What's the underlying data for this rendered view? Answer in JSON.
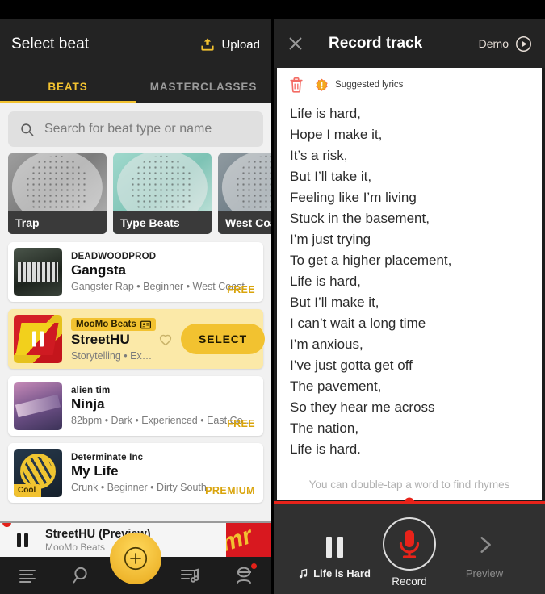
{
  "left_panel": {
    "header": {
      "title": "Select beat",
      "upload_label": "Upload",
      "upload_icon": "upload-icon"
    },
    "tabs": [
      {
        "label": "BEATS",
        "active": true
      },
      {
        "label": "MASTERCLASSES",
        "active": false
      }
    ],
    "search": {
      "placeholder": "Search for beat type or name",
      "value": "",
      "icon": "search-icon"
    },
    "categories": [
      {
        "label": "Trap"
      },
      {
        "label": "Type Beats"
      },
      {
        "label": "West Coast"
      }
    ],
    "beats": [
      {
        "artist": "DEADWOODPROD",
        "title": "Gangsta",
        "meta": "Gangster Rap • Beginner • West Coast",
        "price": "FREE",
        "selected": false
      },
      {
        "artist": "MooMo Beats",
        "artist_badge_icon": "verified-card-icon",
        "title": "StreetHU",
        "meta": "Storytelling • Experien…",
        "select_label": "SELECT",
        "favorite_icon": "heart-outline-icon",
        "selected": true
      },
      {
        "artist": "alien tim",
        "title": "Ninja",
        "meta": "82bpm • Dark • Experienced • East Co…",
        "price": "FREE",
        "selected": false
      },
      {
        "artist": "Determinate Inc",
        "title": "My Life",
        "meta": "Crunk • Beginner • Dirty South",
        "price": "PREMIUM",
        "badge": "Cool",
        "selected": false
      }
    ],
    "mini_player": {
      "title": "StreetHU (Preview)",
      "subtitle": "MooMo Beats",
      "pause_icon": "pause-icon",
      "banner_text": "mr"
    },
    "bottom_nav": [
      {
        "name": "feed",
        "icon": "list-lines-icon"
      },
      {
        "name": "search",
        "icon": "magnifier-icon"
      },
      {
        "name": "create",
        "icon": "plus-circle-icon"
      },
      {
        "name": "playlist",
        "icon": "playlist-note-icon"
      },
      {
        "name": "profile",
        "icon": "person-icon",
        "has_dot": true
      }
    ]
  },
  "right_panel": {
    "header": {
      "close_icon": "close-x-icon",
      "title": "Record track",
      "demo_label": "Demo",
      "demo_icon": "play-circle-icon"
    },
    "tools": {
      "trash_icon": "trash-icon",
      "suggested_icon": "exclamation-badge-icon",
      "suggested_label": "Suggested lyrics"
    },
    "lyrics": "Life is hard,\nHope I make it,\nIt’s a risk,\nBut I’ll take it,\nFeeling like I’m living\nStuck in the basement,\nI’m just trying\nTo get a higher placement,\nLife is hard,\nBut I’ll make it,\nI can’t wait a long time\nI’m anxious,\nI’ve just gotta get off\nThe pavement,\nSo they hear me across\nThe nation,\nLife is hard.",
    "hint": "You can double-tap a word to find rhymes",
    "progress_percent": 50,
    "controls": {
      "left": {
        "label": "Life is Hard",
        "icon": "music-note-icon",
        "state_icon": "pause-icon"
      },
      "center": {
        "label": "Record",
        "icon": "microphone-icon"
      },
      "right": {
        "label": "Preview",
        "icon": "chevron-right-icon"
      }
    }
  },
  "colors": {
    "accent_yellow": "#f2c230",
    "record_red": "#e8231a",
    "dark_bg": "#1c1c1c",
    "header_bg": "#232323"
  }
}
